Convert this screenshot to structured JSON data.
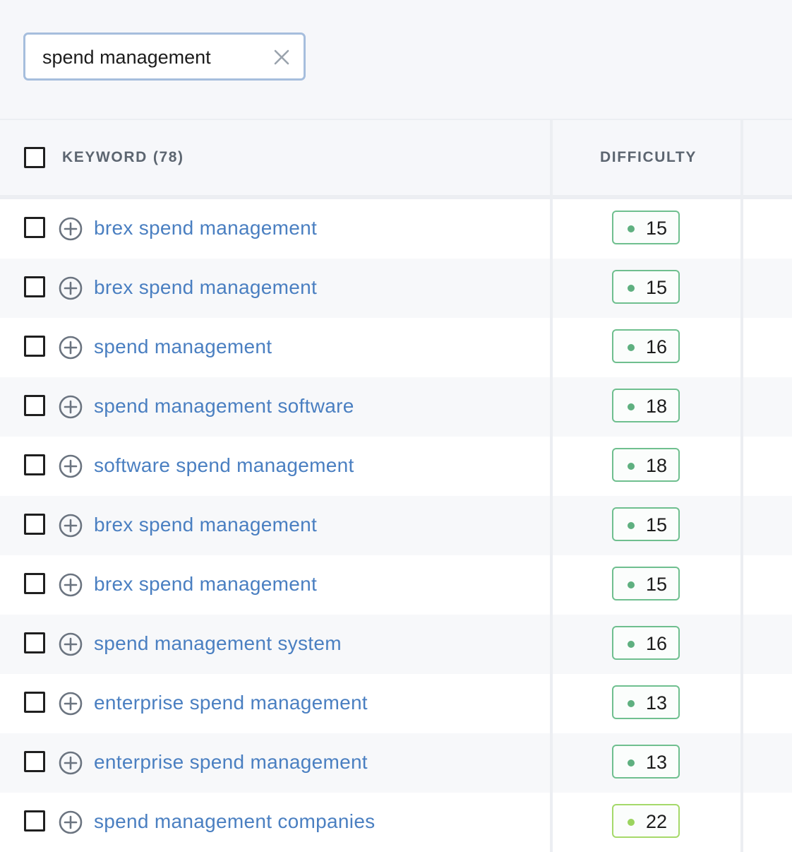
{
  "search": {
    "value": "spend management"
  },
  "table": {
    "header": {
      "keyword_label": "KEYWORD",
      "keyword_count": "(78)",
      "difficulty_label": "DIFFICULTY"
    },
    "rows": [
      {
        "keyword": "brex spend management",
        "difficulty": "15",
        "level": "easy"
      },
      {
        "keyword": "brex spend management",
        "difficulty": "15",
        "level": "easy"
      },
      {
        "keyword": "spend management",
        "difficulty": "16",
        "level": "easy"
      },
      {
        "keyword": "spend management software",
        "difficulty": "18",
        "level": "easy"
      },
      {
        "keyword": "software spend management",
        "difficulty": "18",
        "level": "easy"
      },
      {
        "keyword": "brex spend management",
        "difficulty": "15",
        "level": "easy"
      },
      {
        "keyword": "brex spend management",
        "difficulty": "15",
        "level": "easy"
      },
      {
        "keyword": "spend management system",
        "difficulty": "16",
        "level": "easy"
      },
      {
        "keyword": "enterprise spend management",
        "difficulty": "13",
        "level": "easy"
      },
      {
        "keyword": "enterprise spend management",
        "difficulty": "13",
        "level": "easy"
      },
      {
        "keyword": "spend management companies",
        "difficulty": "22",
        "level": "fairly-easy"
      }
    ]
  },
  "colors": {
    "link": "#4a7fc1",
    "badge_easy_border": "#6fbf8f",
    "badge_easy_dot": "#5fb080",
    "badge_fairly_easy_border": "#a5d96a",
    "badge_fairly_easy_dot": "#9bd45e",
    "search_border": "#a6bedd"
  },
  "icons": {
    "clear": "close-icon",
    "add": "plus-circle-icon"
  }
}
